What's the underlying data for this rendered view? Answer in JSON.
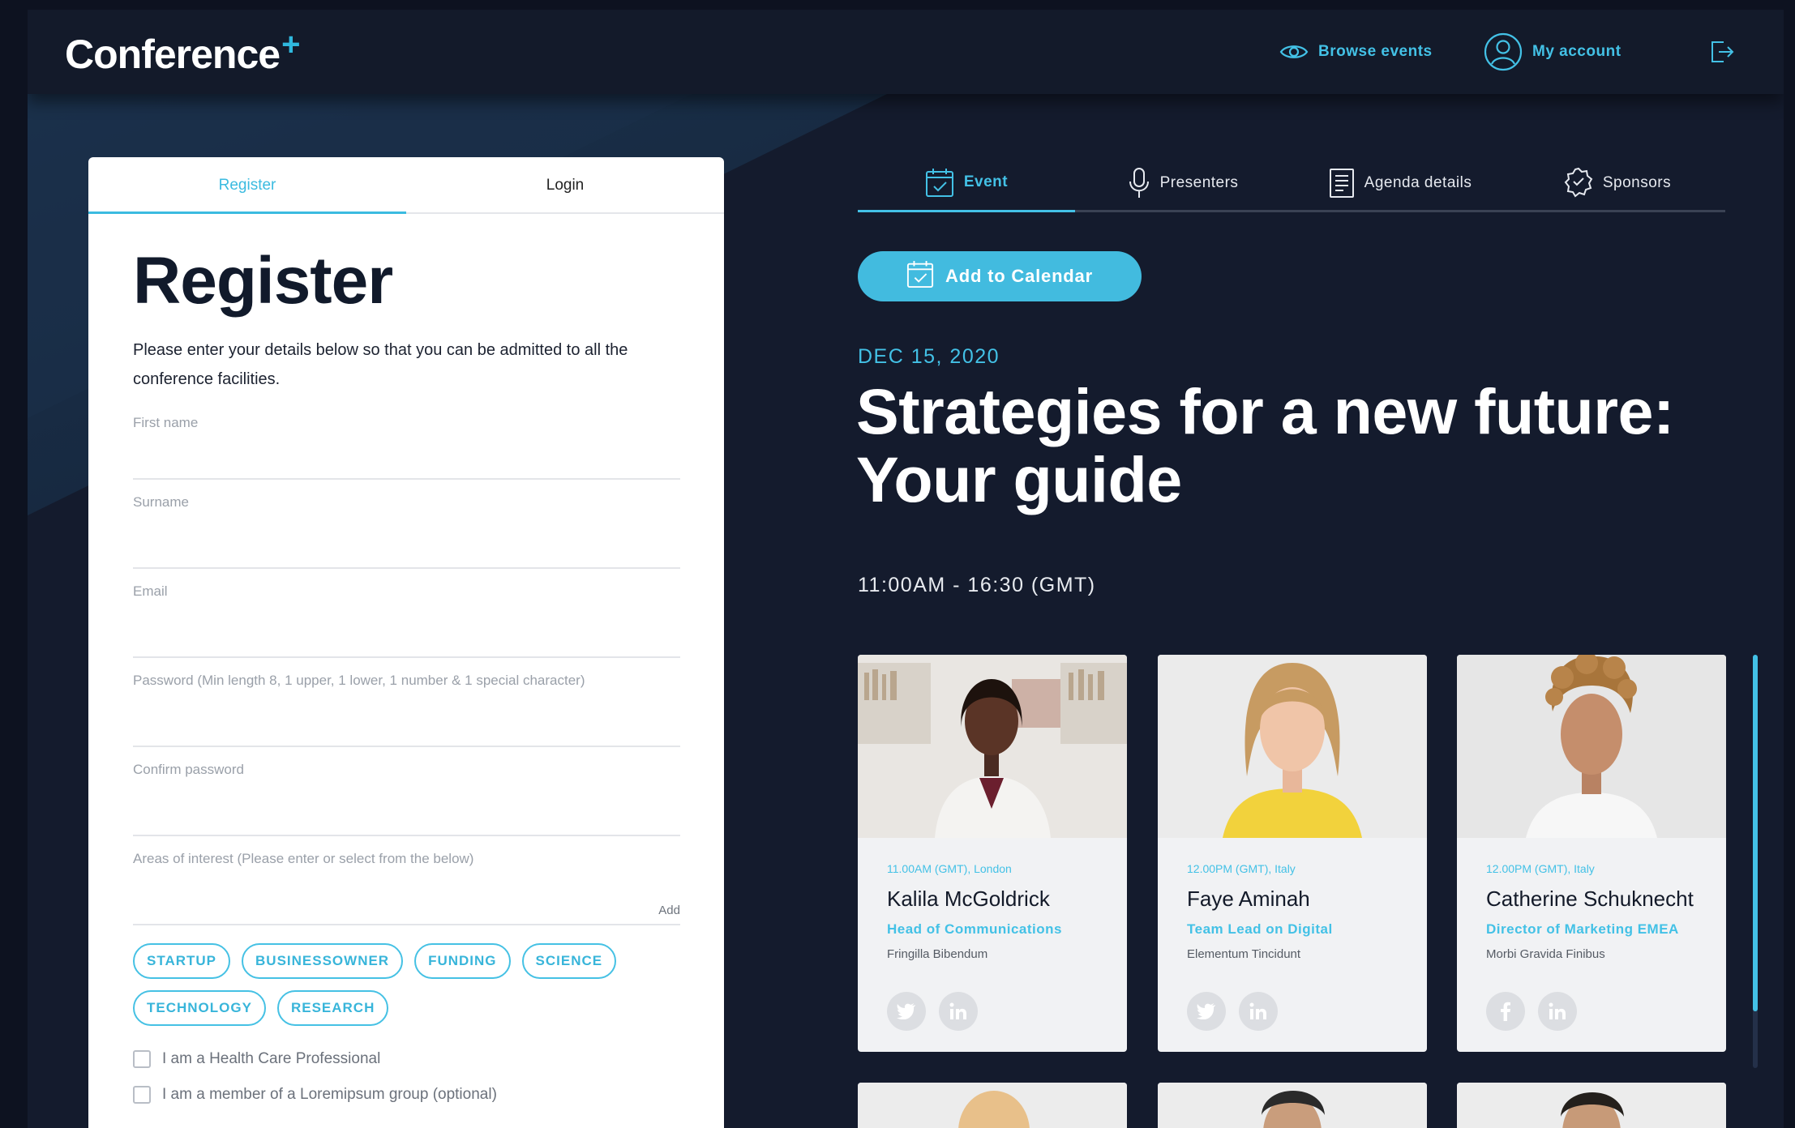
{
  "header": {
    "logo": "Conference",
    "logo_mark": "+",
    "browse_events": "Browse events",
    "my_account": "My account"
  },
  "card": {
    "tabs": [
      {
        "label": "Register"
      },
      {
        "label": "Login"
      }
    ],
    "title": "Register",
    "description": "Please enter your details below so that you can be admitted to all the conference facilities.",
    "fields": [
      {
        "label": "First name"
      },
      {
        "label": "Surname"
      },
      {
        "label": "Email"
      },
      {
        "label": "Password (Min length 8, 1 upper, 1 lower, 1 number & 1 special character)"
      },
      {
        "label": "Confirm password"
      },
      {
        "label": "Areas of interest (Please enter or select from the below)",
        "action": "Add"
      }
    ],
    "chips": [
      "STARTUP",
      "BUSINESSOWNER",
      "FUNDING",
      "SCIENCE",
      "TECHNOLOGY",
      "RESEARCH"
    ],
    "checkboxes": [
      {
        "label": "I am a Health Care Professional",
        "checked": false
      },
      {
        "label": "I am a member of a Loremipsum group (optional)",
        "checked": false
      }
    ]
  },
  "event": {
    "tabs": [
      {
        "label": "Event",
        "icon": "calendar-check-icon"
      },
      {
        "label": "Presenters",
        "icon": "microphone-icon"
      },
      {
        "label": "Agenda details",
        "icon": "document-icon"
      },
      {
        "label": "Sponsors",
        "icon": "badge-icon"
      }
    ],
    "add_to_calendar": "Add to Calendar",
    "date": "DEC 15,  2020",
    "title_line1": "Strategies for a new future:",
    "title_line2": "Your guide",
    "time": "11:00AM - 16:30 (GMT)",
    "speakers": [
      {
        "time": "11.00AM (GMT), London",
        "name": "Kalila McGoldrick",
        "role": "Head of Communications",
        "org": "Fringilla Bibendum",
        "socials": [
          "twitter-icon",
          "linkedin-icon"
        ]
      },
      {
        "time": "12.00PM (GMT), Italy",
        "name": "Faye Aminah",
        "role": "Team Lead on Digital",
        "org": "Elementum Tincidunt",
        "socials": [
          "twitter-icon",
          "linkedin-icon"
        ]
      },
      {
        "time": "12.00PM (GMT), Italy",
        "name": "Catherine Schuknecht",
        "role": "Director of Marketing EMEA",
        "org": "Morbi Gravida Finibus",
        "socials": [
          "facebook-icon",
          "linkedin-icon"
        ]
      }
    ]
  },
  "colors": {
    "accent": "#43c1e6",
    "background": "#141b2d",
    "card": "#ffffff"
  }
}
